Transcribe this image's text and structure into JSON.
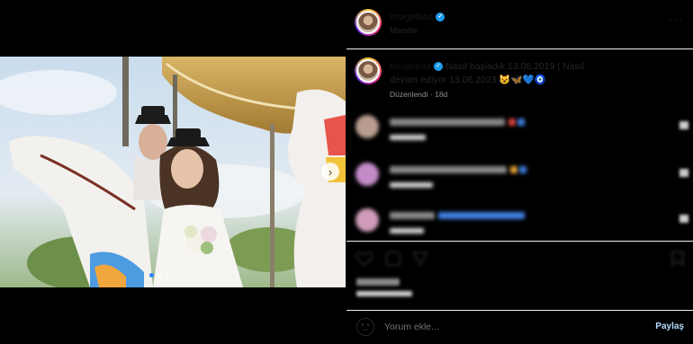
{
  "post": {
    "username": "mugeboz",
    "location": "Marsille",
    "caption_text": "Nasıl başladık 13.06.2019 | Nasıl devam ediyor 13.06.2023",
    "caption_emoji": "😺🦋💙🧿",
    "edited_label": "Düzenlendi",
    "age": "18d"
  },
  "media": {
    "next_icon": "chevron-right-icon",
    "carousel_count": 3,
    "carousel_active": 1
  },
  "comments": [
    {
      "avatar_color": "#b89c8e",
      "line_width": 128,
      "line_color": "#8a8a8a",
      "sub_width": 40,
      "emoji_colors": [
        "#d9413c",
        "#3f7fe0"
      ]
    },
    {
      "avatar_color": "#c38cc9",
      "line_width": 130,
      "line_color": "#8a8a8a",
      "sub_width": 48,
      "emoji_colors": [
        "#e8a637",
        "#3f7fe0"
      ]
    },
    {
      "avatar_color": "#cf9bb8",
      "line_width": 50,
      "line_color": "#8a8a8a",
      "sub_width": 38,
      "emoji_colors": [
        "#3f7fe0",
        "#3f7fe0",
        "#3f7fe0",
        "#3f7fe0",
        "#3f7fe0",
        "#3f7fe0"
      ]
    }
  ],
  "actions": {
    "like_icon": "heart-icon",
    "comment_icon": "comment-icon",
    "share_icon": "share-icon",
    "save_icon": "bookmark-icon"
  },
  "add_comment": {
    "placeholder": "Yorum ekle...",
    "post_label": "Paylaş",
    "emoji_icon": "smile-icon"
  },
  "colors": {
    "accent": "#1d9bf0",
    "post_button_disabled": "#b3dbff"
  }
}
